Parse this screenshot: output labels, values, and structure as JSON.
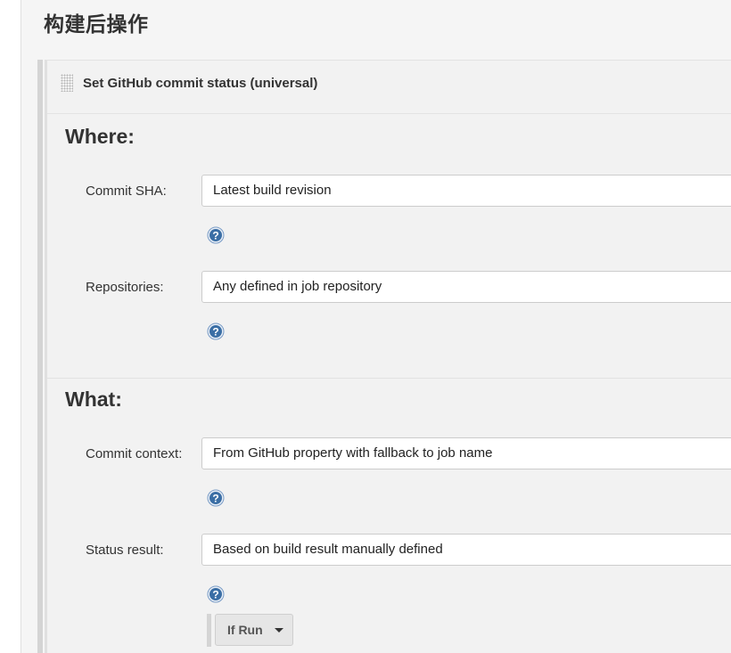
{
  "section": {
    "title": "构建后操作"
  },
  "step": {
    "title": "Set GitHub commit status (universal)"
  },
  "where": {
    "heading": "Where:",
    "commit_sha": {
      "label": "Commit SHA:",
      "value": "Latest build revision"
    },
    "repositories": {
      "label": "Repositories:",
      "value": "Any defined in job repository"
    }
  },
  "what": {
    "heading": "What:",
    "commit_context": {
      "label": "Commit context:",
      "value": "From GitHub property with fallback to job name"
    },
    "status_result": {
      "label": "Status result:",
      "value": "Based on build result manually defined"
    }
  },
  "if_run": {
    "label": "If Run"
  },
  "colors": {
    "help_icon": "#3a6ea5",
    "panel_bg": "#f2f2f2"
  },
  "icons": {
    "help": "question-mark-circle",
    "dropdown": "caret-down",
    "drag": "drag-handle-dots"
  }
}
